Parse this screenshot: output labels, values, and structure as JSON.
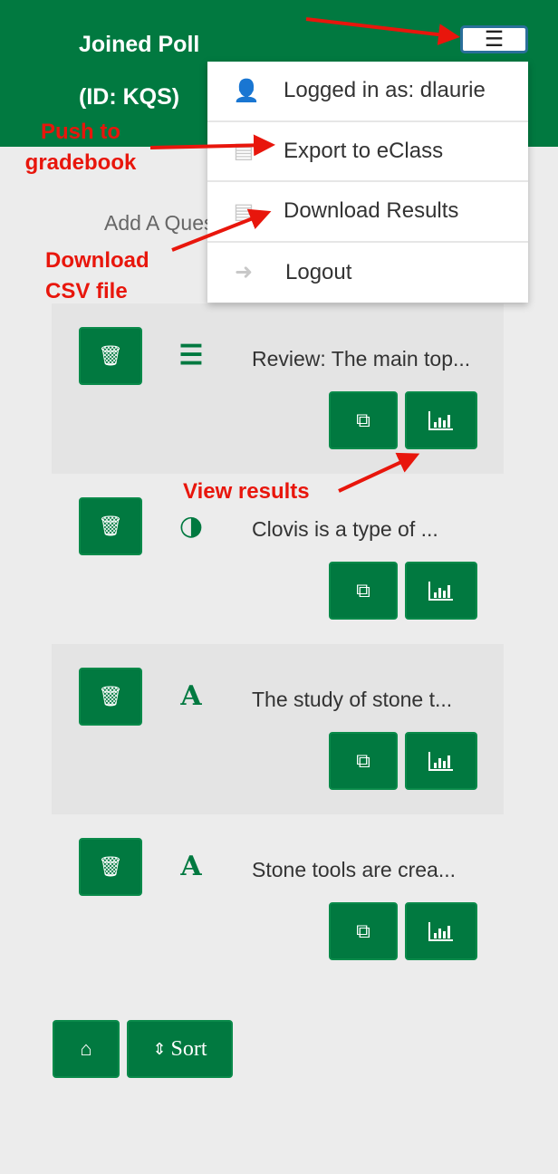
{
  "header": {
    "title_line1": "Joined Poll",
    "title_line2": "(ID: KQS)",
    "menu_icon": "hamburger-icon"
  },
  "add_question": "Add A Question",
  "dropdown": [
    {
      "icon": "user-icon",
      "label": "Logged in as: dlaurie"
    },
    {
      "icon": "file-icon",
      "label": "Export to eClass"
    },
    {
      "icon": "file-icon",
      "label": "Download Results"
    },
    {
      "icon": "logout-icon",
      "label": "Logout"
    }
  ],
  "questions": [
    {
      "type_icon": "list-icon",
      "text": "Review: The main top..."
    },
    {
      "type_icon": "half-circle-icon",
      "text": "Clovis is a type of ..."
    },
    {
      "type_icon": "text-a-icon",
      "text": "The study of stone t..."
    },
    {
      "type_icon": "text-a-icon",
      "text": "Stone tools are crea..."
    }
  ],
  "footer": {
    "home_icon": "home-icon",
    "sort_label": "Sort"
  },
  "annotations": {
    "push": "Push to gradebook",
    "download": "Download CSV file",
    "view": "View results"
  },
  "colors": {
    "brand": "#017940",
    "annotation": "#e8160c"
  }
}
